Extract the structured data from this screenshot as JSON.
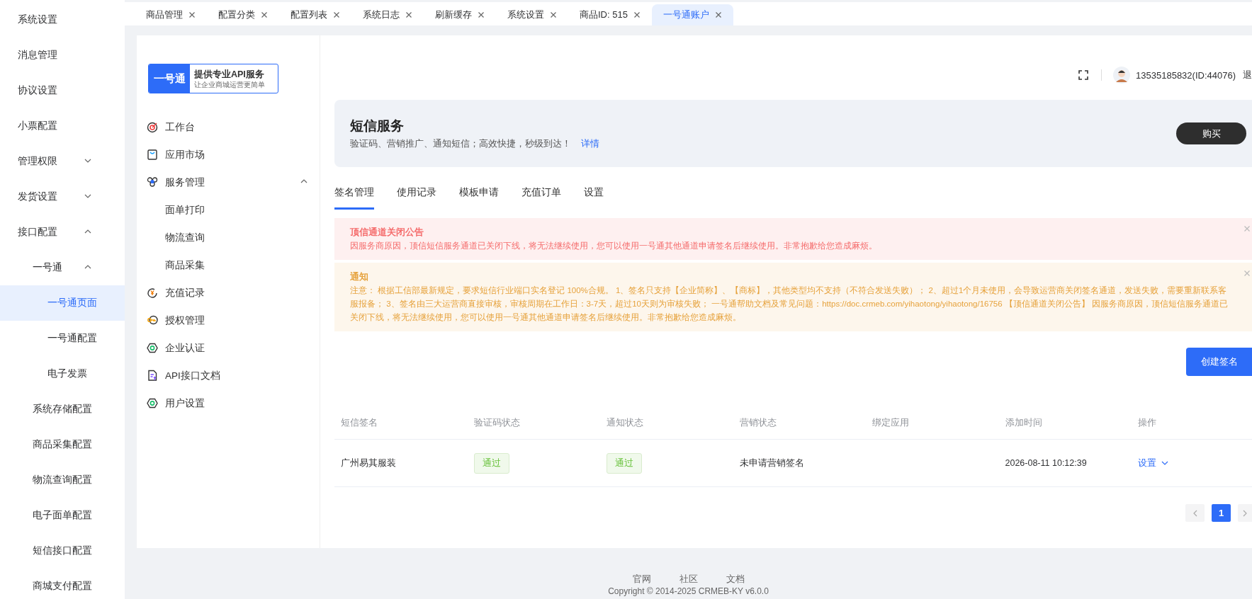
{
  "sidebar": {
    "items": [
      {
        "label": "系统设置",
        "selected": false
      },
      {
        "label": "消息管理",
        "selected": false
      },
      {
        "label": "协议设置",
        "selected": false
      },
      {
        "label": "小票配置",
        "selected": false
      },
      {
        "label": "管理权限",
        "selected": false,
        "expanded": false
      },
      {
        "label": "发货设置",
        "selected": false,
        "expanded": false
      },
      {
        "label": "接口配置",
        "selected": false,
        "expanded": true,
        "children": [
          {
            "label": "一号通",
            "selected": false,
            "expanded": true,
            "children": [
              {
                "label": "一号通页面",
                "selected": true
              },
              {
                "label": "一号通配置",
                "selected": false
              },
              {
                "label": "电子发票",
                "selected": false
              }
            ]
          },
          {
            "label": "系统存储配置",
            "selected": false
          },
          {
            "label": "商品采集配置",
            "selected": false
          },
          {
            "label": "物流查询配置",
            "selected": false
          },
          {
            "label": "电子面单配置",
            "selected": false
          },
          {
            "label": "短信接口配置",
            "selected": false
          },
          {
            "label": "商城支付配置",
            "selected": false
          }
        ]
      }
    ]
  },
  "top_tabs": [
    {
      "label": "商品管理",
      "selected": false
    },
    {
      "label": "配置分类",
      "selected": false
    },
    {
      "label": "配置列表",
      "selected": false
    },
    {
      "label": "系统日志",
      "selected": false
    },
    {
      "label": "刷新缓存",
      "selected": false
    },
    {
      "label": "系统设置",
      "selected": false
    },
    {
      "label": "商品ID: 515",
      "selected": false
    },
    {
      "label": "一号通账户",
      "selected": true
    }
  ],
  "logo": {
    "brand": "一号通",
    "title": "提供专业API服务",
    "subtitle": "让企业商城运营更简单"
  },
  "service_menu": [
    {
      "label": "工作台",
      "selected": false
    },
    {
      "label": "应用市场",
      "selected": false
    },
    {
      "label": "服务管理",
      "selected": false,
      "expanded": true,
      "children": [
        {
          "label": "面单打印",
          "selected": false
        },
        {
          "label": "物流查询",
          "selected": false
        },
        {
          "label": "商品采集",
          "selected": false
        }
      ]
    },
    {
      "label": "充值记录",
      "selected": false
    },
    {
      "label": "授权管理",
      "selected": false
    },
    {
      "label": "企业认证",
      "selected": false
    },
    {
      "label": "API接口文档",
      "selected": false
    },
    {
      "label": "用户设置",
      "selected": false
    }
  ],
  "header": {
    "user": "13535185832(ID:44076)",
    "logout": "退"
  },
  "banner": {
    "title": "短信服务",
    "description": "验证码、营销推广、通知短信；高效快捷，秒级到达！",
    "link": "详情",
    "button": "购买"
  },
  "service_tabs": [
    {
      "label": "签名管理",
      "selected": true
    },
    {
      "label": "使用记录",
      "selected": false
    },
    {
      "label": "模板申请",
      "selected": false
    },
    {
      "label": "充值订单",
      "selected": false
    },
    {
      "label": "设置",
      "selected": false
    }
  ],
  "alerts": [
    {
      "kind": "error",
      "title": "顶信通道关闭公告",
      "text": "因服务商原因，顶信短信服务通道已关闭下线，将无法继续使用，您可以使用一号通其他通道申请签名后继续使用。非常抱歉给您造成麻烦。"
    },
    {
      "kind": "warning",
      "title": "通知",
      "text": "注意： 根据工信部最新规定，要求短信行业端口实名登记 100%合规。 1、签名只支持【企业简称】、【商标】，其他类型均不支持（不符合发送失败）； 2、超过1个月未使用，会导致运营商关闭签名通道，发送失败，需要重新联系客服报备； 3、签名由三大运营商直接审核，审核周期在工作日：3-7天，超过10天则为审核失败； 一号通帮助文档及常见问题：https://doc.crmeb.com/yihaotong/yihaotong/16756 【顶信通道关闭公告】 因服务商原因，顶信短信服务通道已关闭下线，将无法继续使用，您可以使用一号通其他通道申请签名后继续使用。非常抱歉给您造成麻烦。"
    }
  ],
  "create_button": "创建签名",
  "table": {
    "columns": [
      "短信签名",
      "验证码状态",
      "通知状态",
      "营销状态",
      "绑定应用",
      "添加时间",
      "操作"
    ],
    "rows": [
      {
        "signature": "广州易其服装",
        "code_status": "通过",
        "notice_status": "通过",
        "marketing_status": "未申请营销签名",
        "added_at": "2026-08-11 10:12:39",
        "action": "设置"
      }
    ]
  },
  "pagination": {
    "pages": [
      {
        "label": "1",
        "selected": true
      }
    ]
  },
  "footer": {
    "links": [
      "官网",
      "社区",
      "文档"
    ],
    "copyright": "Copyright © 2014-2025 CRMEB-KY v6.0.0"
  }
}
